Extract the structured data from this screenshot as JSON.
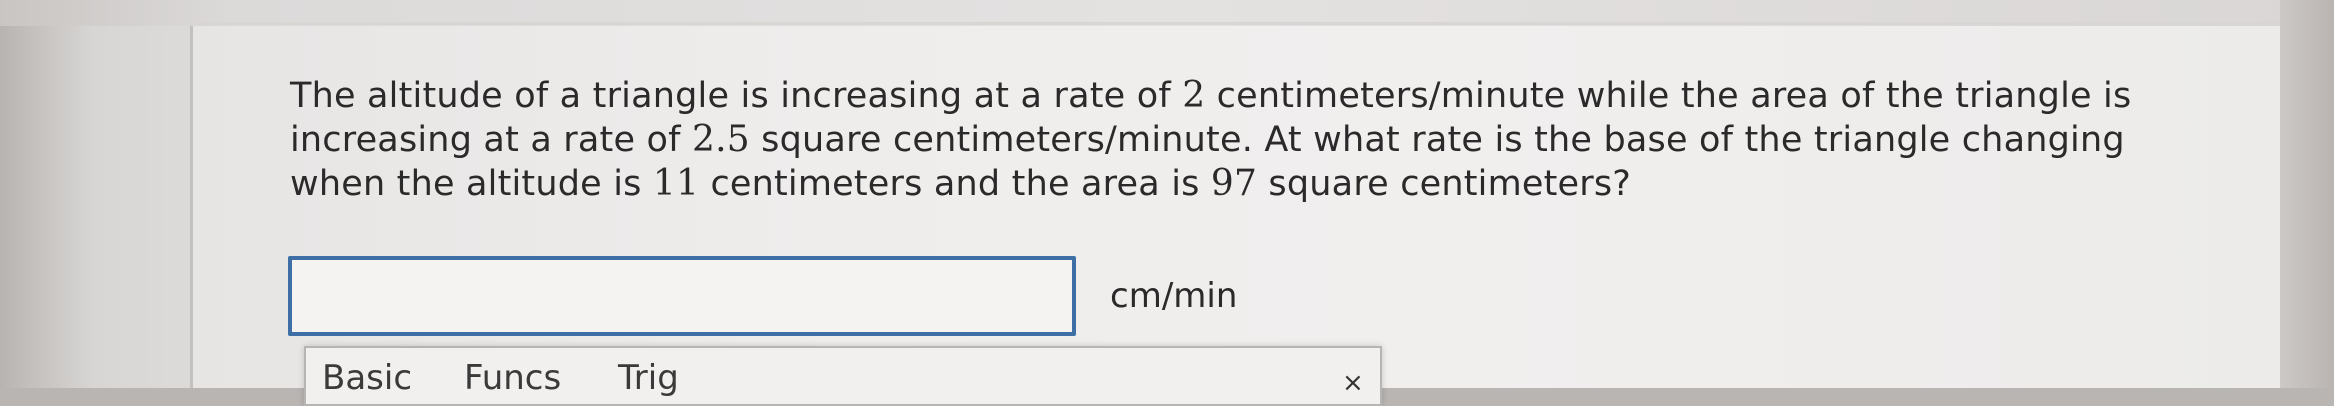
{
  "question": {
    "part1": "The altitude of a triangle is increasing at a rate of ",
    "rate_altitude": "2",
    "part2": " centimeters/minute while the area of the triangle is increasing at a rate of ",
    "rate_area": "2.5",
    "part3": " square centimeters/minute. At what rate is the base of the triangle changing when the altitude is ",
    "altitude": "11",
    "part4": " centimeters and the area is ",
    "area": "97",
    "part5": " square centimeters?"
  },
  "answer": {
    "value": "",
    "placeholder": "",
    "unit": "cm/min"
  },
  "keypad": {
    "tabs": [
      "Basic",
      "Funcs",
      "Trig"
    ],
    "close_icon": "×"
  },
  "colors": {
    "input_border": "#3d6fa4",
    "text": "#2b2a2a"
  }
}
